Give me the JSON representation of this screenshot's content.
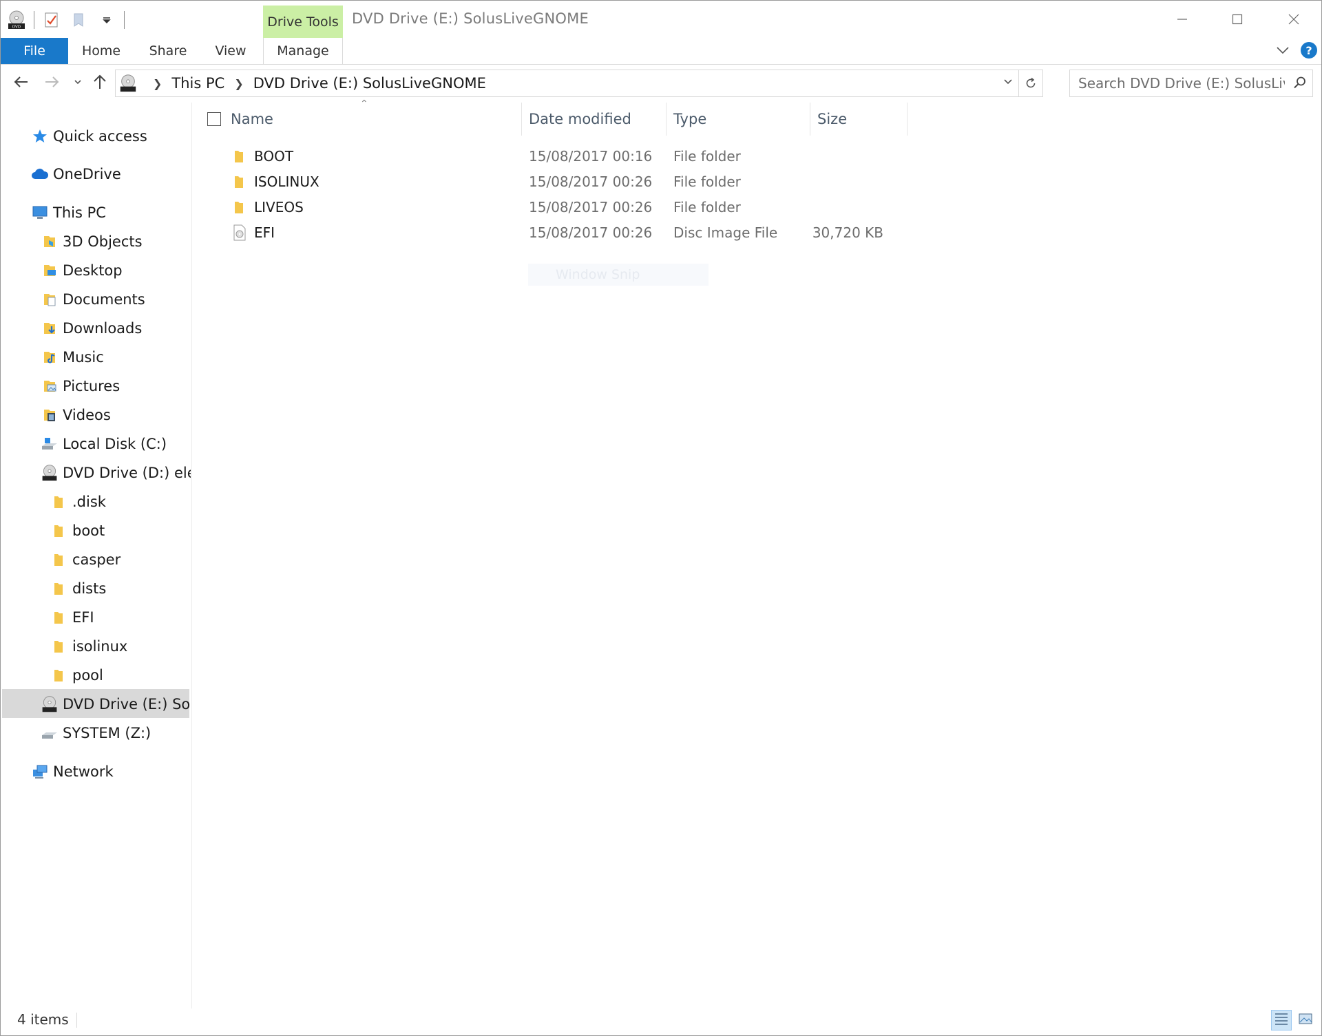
{
  "window": {
    "title": "DVD Drive (E:) SolusLiveGNOME",
    "contextual_tab": "Drive Tools"
  },
  "ribbon": {
    "tabs": [
      "File",
      "Home",
      "Share",
      "View",
      "Manage"
    ]
  },
  "address": {
    "crumbs": [
      "This PC",
      "DVD Drive (E:) SolusLiveGNOME"
    ]
  },
  "search": {
    "placeholder": "Search DVD Drive (E:) SolusLive..."
  },
  "sidebar": {
    "items": [
      {
        "label": "Quick access",
        "icon": "star-icon"
      },
      {
        "label": "OneDrive",
        "icon": "cloud-icon"
      },
      {
        "label": "This PC",
        "icon": "computer-icon"
      },
      {
        "label": "3D Objects",
        "icon": "3d-objects-icon"
      },
      {
        "label": "Desktop",
        "icon": "desktop-icon"
      },
      {
        "label": "Documents",
        "icon": "documents-icon"
      },
      {
        "label": "Downloads",
        "icon": "downloads-icon"
      },
      {
        "label": "Music",
        "icon": "music-icon"
      },
      {
        "label": "Pictures",
        "icon": "pictures-icon"
      },
      {
        "label": "Videos",
        "icon": "videos-icon"
      },
      {
        "label": "Local Disk (C:)",
        "icon": "local-disk-icon"
      },
      {
        "label": "DVD Drive (D:) elem",
        "icon": "dvd-drive-icon"
      },
      {
        "label": ".disk",
        "icon": "folder-icon"
      },
      {
        "label": "boot",
        "icon": "folder-icon"
      },
      {
        "label": "casper",
        "icon": "folder-icon"
      },
      {
        "label": "dists",
        "icon": "folder-icon"
      },
      {
        "label": "EFI",
        "icon": "folder-icon"
      },
      {
        "label": "isolinux",
        "icon": "folder-icon"
      },
      {
        "label": "pool",
        "icon": "folder-icon"
      },
      {
        "label": "DVD Drive (E:) Solus",
        "icon": "dvd-drive-icon",
        "selected": true
      },
      {
        "label": "SYSTEM (Z:)",
        "icon": "drive-icon"
      },
      {
        "label": "Network",
        "icon": "network-icon"
      }
    ]
  },
  "columns": {
    "name": "Name",
    "date": "Date modified",
    "type": "Type",
    "size": "Size"
  },
  "files": [
    {
      "name": "BOOT",
      "date": "15/08/2017 00:16",
      "type": "File folder",
      "size": "",
      "icon": "folder-icon"
    },
    {
      "name": "ISOLINUX",
      "date": "15/08/2017 00:26",
      "type": "File folder",
      "size": "",
      "icon": "folder-icon"
    },
    {
      "name": "LIVEOS",
      "date": "15/08/2017 00:26",
      "type": "File folder",
      "size": "",
      "icon": "folder-icon"
    },
    {
      "name": "EFI",
      "date": "15/08/2017 00:26",
      "type": "Disc Image File",
      "size": "30,720 KB",
      "icon": "disc-image-icon"
    }
  ],
  "ghost": {
    "label": "Window Snip"
  },
  "status": {
    "count": "4 items"
  },
  "colors": {
    "accent": "#1979ca",
    "drive_tools": "#cbefa5",
    "folder": "#f4c64b",
    "selection": "#d9d9d9"
  }
}
